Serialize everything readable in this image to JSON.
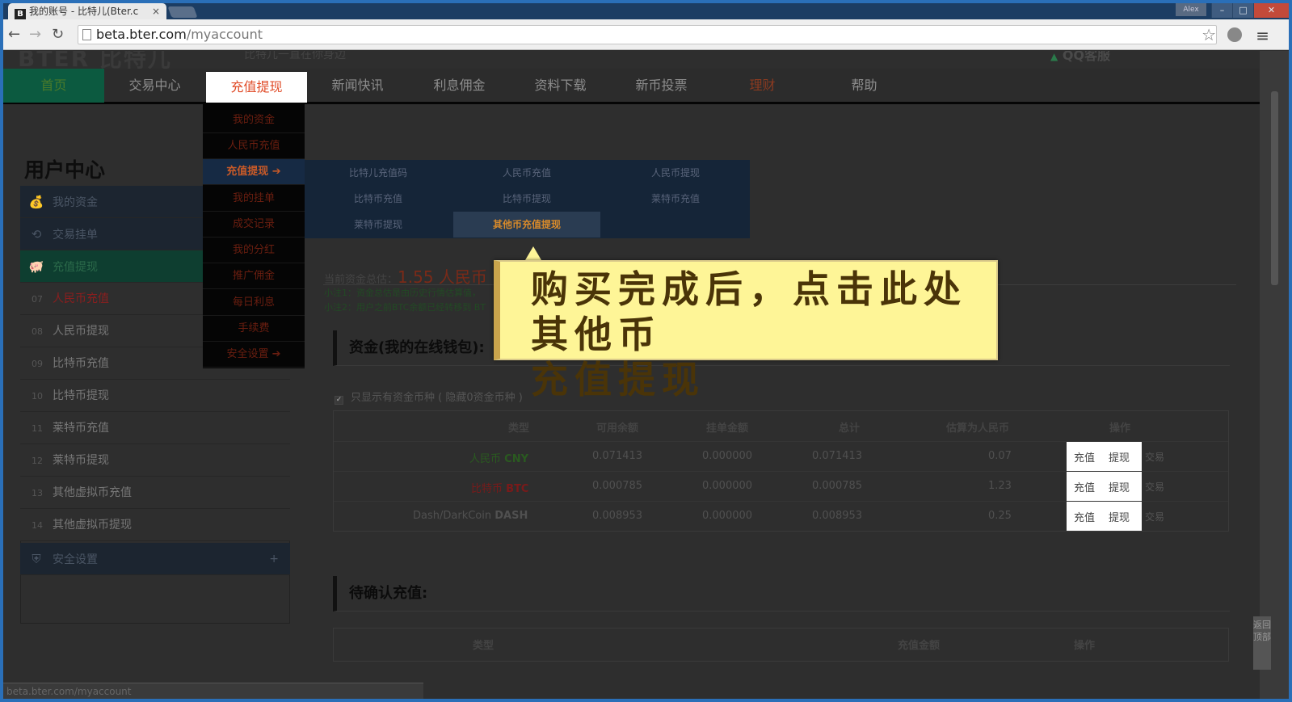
{
  "browser": {
    "tab_title": "我的账号 - 比特儿(Bter.c",
    "tab_favicon": "B",
    "tab_close": "×",
    "user_badge": "Alex",
    "min_icon": "–",
    "max_icon": "□",
    "close_icon": "✕",
    "url_host": "beta.bter.com",
    "url_path": "/myaccount",
    "status_url": "beta.bter.com/myaccount",
    "back_icon": "←",
    "forward_icon": "→",
    "reload_icon": "↻",
    "star_icon": "☆",
    "menu_icon": "≡"
  },
  "header": {
    "logo": "BTER 比特儿",
    "slogan": "比特儿一直在你身边",
    "qq_arrow": "▲",
    "qq": "QQ客服"
  },
  "nav": [
    "首页",
    "交易中心",
    "充值提现",
    "新闻快讯",
    "利息佣金",
    "资料下载",
    "新币投票",
    "理财",
    "帮助"
  ],
  "dropdown": [
    "我的资金",
    "人民币充值",
    "充值提现 ➔",
    "我的挂单",
    "成交记录",
    "我的分红",
    "推广佣金",
    "每日利息",
    "手续费",
    "安全设置 ➔"
  ],
  "submenu": [
    "比特儿充值码",
    "人民币充值",
    "人民币提现",
    "比特币充值",
    "比特币提现",
    "莱特币充值",
    "莱特币提现",
    "其他币充值提现"
  ],
  "sidebar": {
    "title": "用户中心",
    "top_items": [
      {
        "icon": "💰",
        "label": "我的资金"
      },
      {
        "icon": "⟲",
        "label": "交易挂单"
      },
      {
        "icon": "🐖",
        "label": "充值提现"
      }
    ],
    "items": [
      {
        "num": "07",
        "label": "人民币充值"
      },
      {
        "num": "08",
        "label": "人民币提现"
      },
      {
        "num": "09",
        "label": "比特币充值"
      },
      {
        "num": "10",
        "label": "比特币提现"
      },
      {
        "num": "11",
        "label": "莱特币充值"
      },
      {
        "num": "12",
        "label": "莱特币提现"
      },
      {
        "num": "13",
        "label": "其他虚拟币充值"
      },
      {
        "num": "14",
        "label": "其他虚拟币提现"
      }
    ],
    "security": {
      "icon": "⛨",
      "label": "安全设置",
      "expand": "+"
    }
  },
  "summary": {
    "label": "当前资金总估：",
    "amount": "1.55 人民币",
    "note1": "小注1：资金总估是由历史行情估算值，",
    "note2": "小注2：用户之前BTC余额已经转移到 BT"
  },
  "wallet": {
    "title": "资金(我的在线钱包):",
    "checkbox_label": "只显示有资金币种 ( 隐藏0资金币种 )",
    "headers": [
      "类型",
      "可用余额",
      "挂单金额",
      "总计",
      "估算为人民币",
      "操作"
    ],
    "rows": [
      {
        "name": "人民币",
        "code": "CNY",
        "available": "0.071413",
        "frozen": "0.000000",
        "total": "0.071413",
        "cny": "0.07"
      },
      {
        "name": "比特币",
        "code": "BTC",
        "available": "0.000785",
        "frozen": "0.000000",
        "total": "0.000785",
        "cny": "1.23"
      },
      {
        "name": "Dash/DarkCoin",
        "code": "DASH",
        "available": "0.008953",
        "frozen": "0.000000",
        "total": "0.008953",
        "cny": "0.25"
      }
    ],
    "op_deposit": "充值",
    "op_withdraw": "提现",
    "op_trade": "交易"
  },
  "pending": {
    "title": "待确认充值:",
    "headers": [
      "类型",
      "充值金额",
      "操作"
    ]
  },
  "back_to_top": "返回顶部",
  "callout": {
    "line1": "购买完成后，点击此处其他币",
    "line2": "充值提现"
  }
}
